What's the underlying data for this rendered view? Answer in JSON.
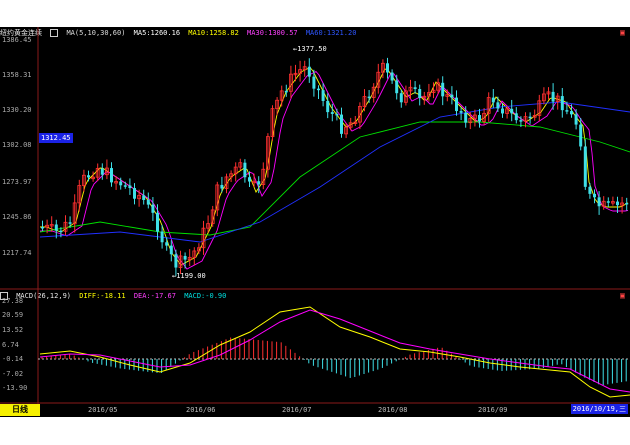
{
  "main_panel": {
    "title": "纽约黄金连续",
    "ma_label": "MA(5,10,30,60)",
    "ma5": "MA5:1260.16",
    "ma10": "MA10:1258.82",
    "ma30": "MA30:1300.57",
    "ma60": "MA60:1321.20",
    "y_labels": [
      "1386.45",
      "1358.31",
      "1330.20",
      "1302.08",
      "1273.97",
      "1245.86",
      "1217.74"
    ],
    "current_price": "1312.45",
    "high_label": "1377.50",
    "low_label": "1199.00"
  },
  "macd_panel": {
    "title": "MACD(26,12,9)",
    "diff": "DIFF:-18.11",
    "dea": "DEA:-17.67",
    "macd": "MACD:-0.90",
    "y_labels": [
      "27.38",
      "20.59",
      "13.52",
      "6.74",
      "-0.14",
      "-7.02",
      "-13.90"
    ]
  },
  "x_axis": {
    "period": "日线",
    "labels": [
      "2016/05",
      "2016/06",
      "2016/07",
      "2016/08",
      "2016/09"
    ],
    "current_date": "2016/10/19,三"
  },
  "colors": {
    "background": "#000000",
    "up_candle": "#ff3030",
    "down_candle": "#3fe0e8",
    "ma5": "#ffffff",
    "ma10": "#ffff00",
    "ma30": "#ff00ff",
    "ma60": "#00e000",
    "ma_blue": "#2030ff",
    "grid": "#8a1a1a",
    "price_box": "#1a22e6",
    "period_box": "#f6f000"
  }
}
